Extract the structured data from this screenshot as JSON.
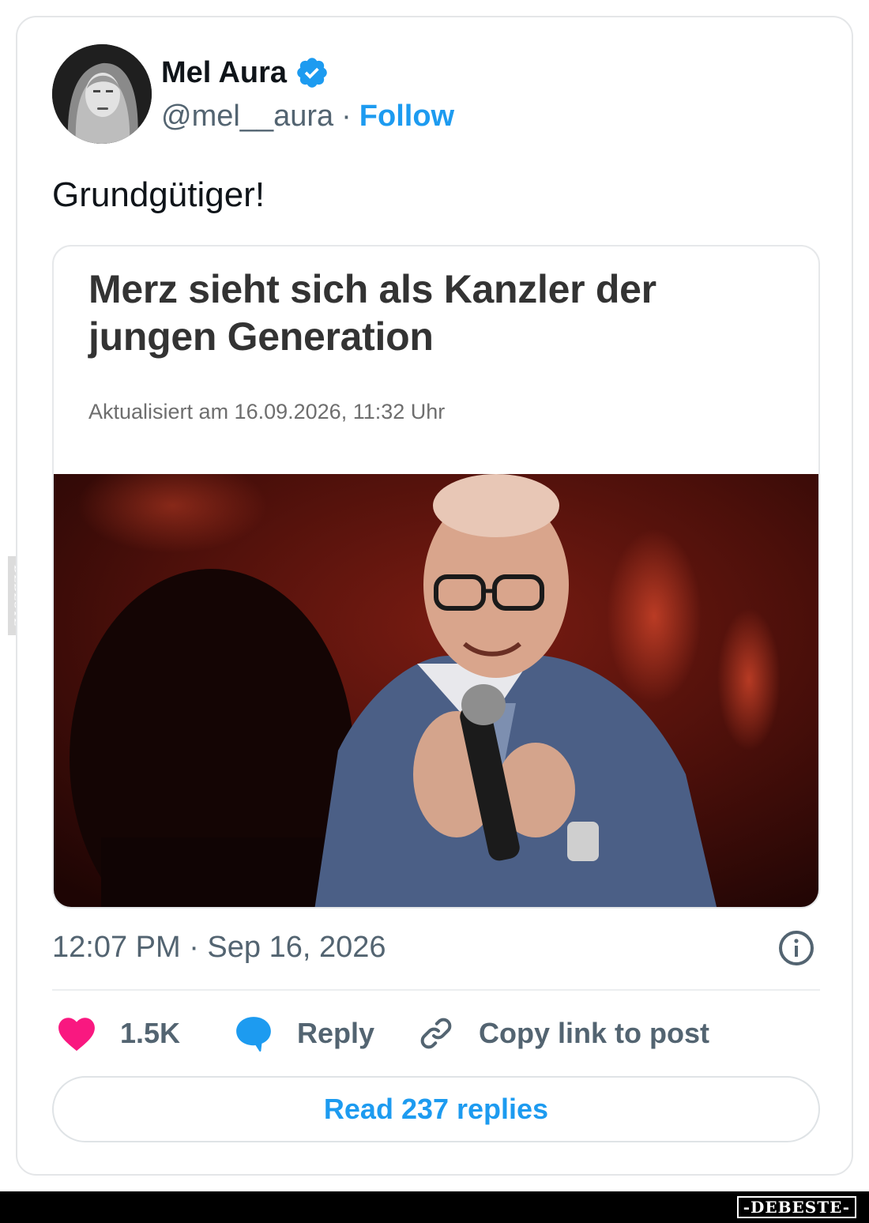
{
  "author": {
    "name": "Mel Aura",
    "handle": "@mel__aura",
    "separator": "·",
    "follow_label": "Follow"
  },
  "tweet": {
    "text": "Grundgütiger!",
    "timestamp": "12:07 PM · Sep 16, 2026"
  },
  "embed": {
    "headline": "Merz sieht sich als Kanzler der jungen Generation",
    "updated": "Aktualisiert am 16.09.2026, 11:32 Uhr"
  },
  "actions": {
    "likes": "1.5K",
    "reply_label": "Reply",
    "copy_label": "Copy link to post"
  },
  "read_replies_label": "Read 237 replies",
  "watermark": {
    "side": "DEBESTE",
    "footer": "-DEBESTE-"
  },
  "colors": {
    "link": "#1d9bf0",
    "like": "#f91880",
    "reply": "#1d9bf0",
    "text": "#0f1419",
    "muted": "#536471"
  },
  "icons": {
    "verified": "verified-badge-icon",
    "like": "heart-icon",
    "reply": "speech-bubble-icon",
    "copy": "link-icon",
    "info": "info-icon"
  }
}
